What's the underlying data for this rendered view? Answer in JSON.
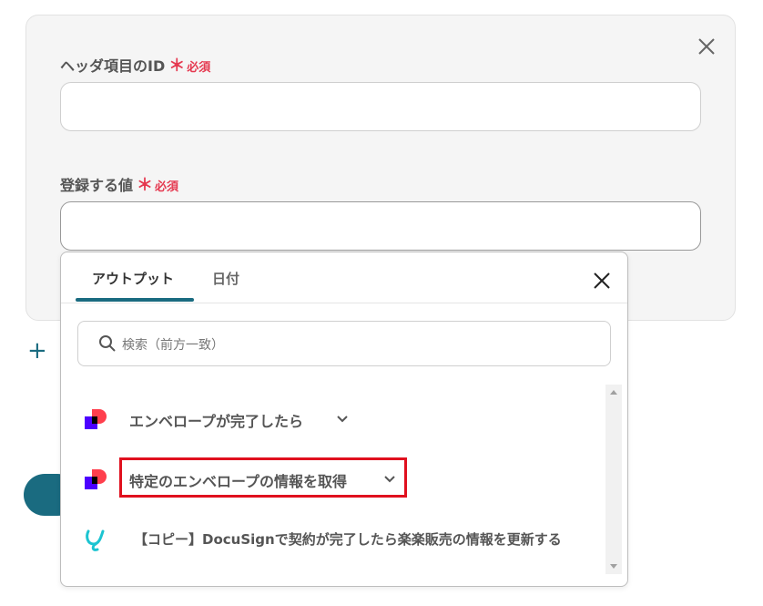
{
  "form": {
    "field1_label": "ヘッダ項目のID",
    "field2_label": "登録する値",
    "required_mark": "＊",
    "required_text": "必須"
  },
  "add_row": {
    "icon": "plus-icon",
    "label": "+"
  },
  "popup": {
    "tabs": [
      {
        "label": "アウトプット",
        "active": true
      },
      {
        "label": "日付",
        "active": false
      }
    ],
    "search_placeholder": "検索（前方一致）",
    "items": [
      {
        "label": "エンベロープが完了したら",
        "icon": "docusign-icon"
      },
      {
        "label": "特定のエンベロープの情報を取得",
        "icon": "docusign-icon"
      },
      {
        "label": "【コピー】DocuSignで契約が完了したら楽楽販売の情報を更新する",
        "icon": "yoom-icon"
      }
    ]
  },
  "colors": {
    "accent": "#1a6b80",
    "required": "#e53950",
    "highlight": "#e0101e",
    "docusign_red": "#ff3f4d",
    "docusign_purple": "#4c00ff",
    "yoom_teal": "#1cc4d1"
  }
}
